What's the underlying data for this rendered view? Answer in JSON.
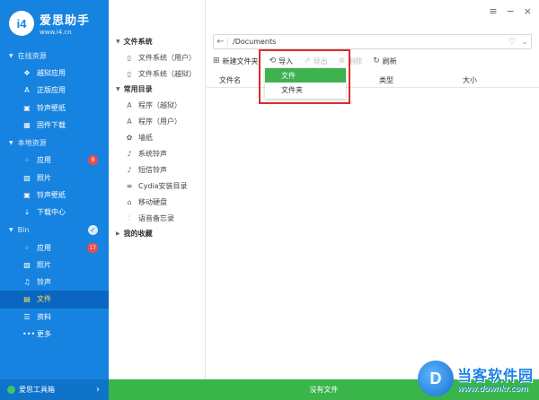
{
  "app": {
    "name": "爱思助手",
    "url": "www.i4.cn",
    "logo_text": "i4"
  },
  "sidebar": {
    "groups": [
      {
        "label": "在线资源",
        "items": [
          {
            "icon": "cube-icon",
            "label": "越狱应用"
          },
          {
            "icon": "app-store-icon",
            "label": "正版应用"
          },
          {
            "icon": "film-icon",
            "label": "铃声壁纸"
          },
          {
            "icon": "firmware-icon",
            "label": "固件下载"
          }
        ]
      },
      {
        "label": "本地资源",
        "items": [
          {
            "icon": "apps-icon",
            "label": "应用",
            "badge": "8"
          },
          {
            "icon": "photo-icon",
            "label": "照片"
          },
          {
            "icon": "film-icon",
            "label": "铃声壁纸"
          },
          {
            "icon": "download-icon",
            "label": "下载中心"
          }
        ]
      },
      {
        "label": "Bin",
        "items": [
          {
            "icon": "apps-icon",
            "label": "应用",
            "badge": "17"
          },
          {
            "icon": "photo-icon",
            "label": "照片"
          },
          {
            "icon": "music-icon",
            "label": "铃声"
          },
          {
            "icon": "folder-icon",
            "label": "文件"
          },
          {
            "icon": "list-icon",
            "label": "资料"
          },
          {
            "icon": "more-icon",
            "label": "更多"
          }
        ]
      }
    ],
    "footer_label": "爱思工具箱"
  },
  "tree": {
    "sections": [
      {
        "label": "文件系统",
        "items": [
          {
            "icon": "file-icon",
            "label": "文件系统（用户）"
          },
          {
            "icon": "file-icon",
            "label": "文件系统（越狱）"
          }
        ]
      },
      {
        "label": "常用目录",
        "items": [
          {
            "icon": "app-store-icon",
            "label": "程序（越狱）"
          },
          {
            "icon": "app-store-icon",
            "label": "程序（用户）"
          },
          {
            "icon": "flower-icon",
            "label": "墙纸"
          },
          {
            "icon": "bell-icon",
            "label": "系统铃声"
          },
          {
            "icon": "bell-icon",
            "label": "短信铃声"
          },
          {
            "icon": "list-icon",
            "label": "Cydia安装目录"
          },
          {
            "icon": "drive-icon",
            "label": "移动硬盘"
          },
          {
            "icon": "voice-icon",
            "label": "语音备忘录"
          }
        ]
      },
      {
        "label": "我的收藏",
        "items": []
      }
    ]
  },
  "address": {
    "path": "/Documents"
  },
  "toolbar": {
    "new_folder": "新建文件夹",
    "import": "导入",
    "export": "导出",
    "delete": "删除",
    "refresh": "刷新"
  },
  "table": {
    "columns": [
      "文件名",
      "类型",
      "大小"
    ]
  },
  "import_menu": {
    "items": [
      "文件",
      "文件夹"
    ]
  },
  "status": {
    "text": "没有文件"
  },
  "watermark": {
    "title": "当客软件园",
    "url": "www.downkr.com"
  },
  "colors": {
    "sidebar": "#1783e0",
    "active_text": "#ffe14a",
    "status_green": "#39b54a",
    "menu_selected": "#3db24e",
    "highlight_red": "#e02a2a",
    "badge_red": "#ef4b4b"
  }
}
